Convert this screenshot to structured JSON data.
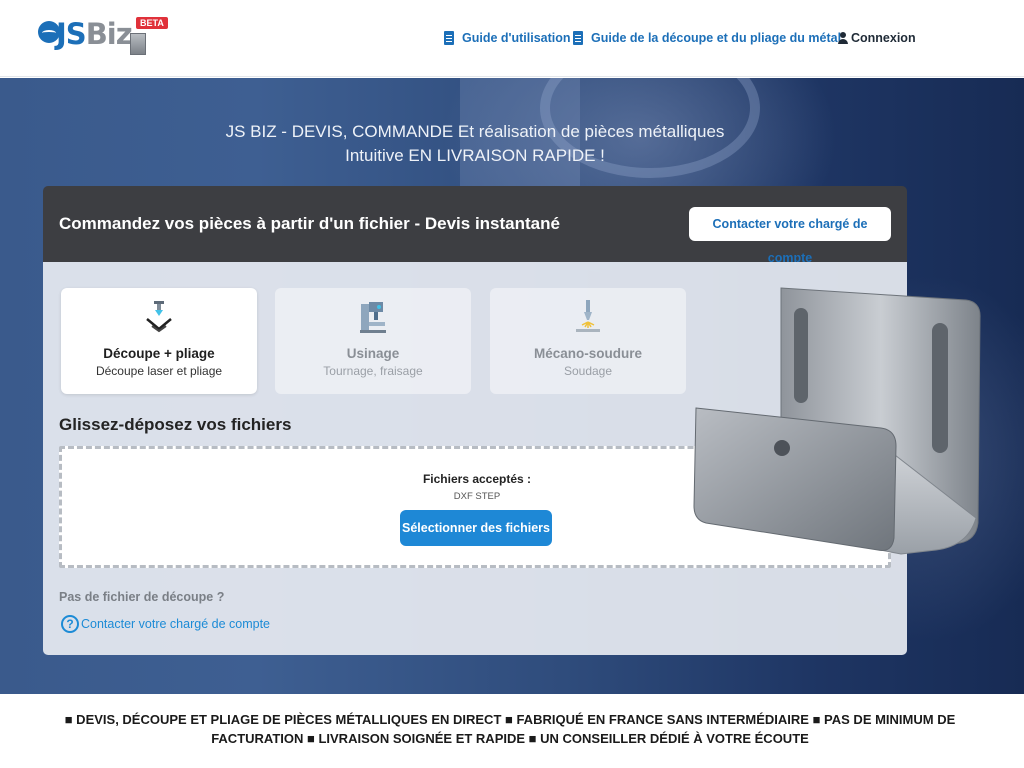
{
  "header": {
    "logo_text_1": "JS",
    "logo_text_2": "Biz",
    "logo_badge": "BETA",
    "nav": [
      {
        "label": "Guide d'utilisation",
        "icon": "document-icon"
      },
      {
        "label": "Guide de la découpe et du pliage du métal",
        "icon": "document-icon"
      },
      {
        "label": "Connexion",
        "icon": "user-icon"
      }
    ]
  },
  "hero": {
    "title_line1": "JS BIZ - DEVIS, COMMANDE Et réalisation de pièces métalliques",
    "title_line2": "Intuitive EN LIVRAISON RAPIDE !"
  },
  "panel": {
    "title": "Commandez vos pièces à partir d'un fichier - Devis instantané",
    "contact_button": "Contacter votre chargé de compte",
    "services": [
      {
        "title": "Découpe + pliage",
        "subtitle": "Découpe laser et pliage",
        "icon": "press-brake-icon",
        "selected": true
      },
      {
        "title": "Usinage",
        "subtitle": "Tournage, fraisage",
        "icon": "milling-machine-icon",
        "selected": false
      },
      {
        "title": "Mécano-soudure",
        "subtitle": "Soudage",
        "icon": "welding-icon",
        "selected": false
      }
    ],
    "drop_title": "Glissez-déposez vos fichiers",
    "accepted_label": "Fichiers acceptés :",
    "accepted_types": "DXF STEP",
    "select_button": "Sélectionner des fichiers",
    "no_file_label": "Pas de fichier de découpe ?",
    "help_link": "Contacter votre chargé de compte",
    "help_icon_glyph": "?"
  },
  "banner": {
    "text": "■ DEVIS, DÉCOUPE ET PLIAGE DE PIÈCES MÉTALLIQUES EN DIRECT ■ FABRIQUÉ EN FRANCE SANS INTERMÉDIAIRE ■ PAS DE MINIMUM DE FACTURATION ■ LIVRAISON SOIGNÉE ET RAPIDE ■ UN CONSEILLER DÉDIÉ À VOTRE ÉCOUTE"
  },
  "colors": {
    "brand_blue": "#1c6fb8",
    "button_blue": "#1e88d6",
    "panel_header": "#3d3e42",
    "beta_red": "#e0313a"
  }
}
